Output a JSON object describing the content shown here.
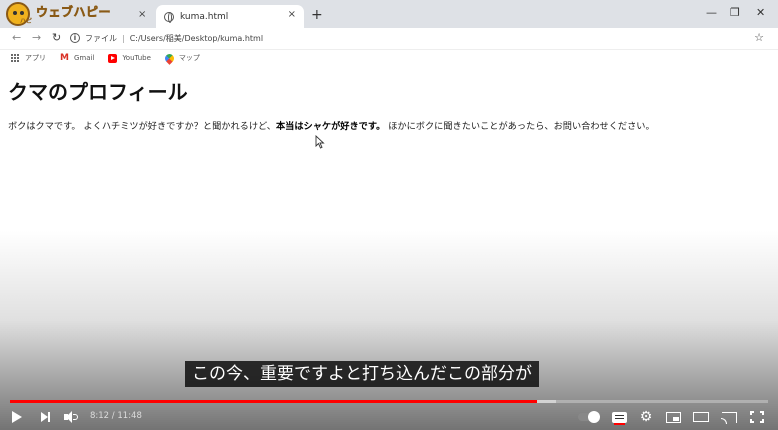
{
  "browser": {
    "tabs": [
      {
        "label": "",
        "active": false
      },
      {
        "label": "kuma.html",
        "active": true
      }
    ],
    "tab_close_glyph": "×",
    "new_tab_glyph": "+",
    "window_controls": [
      "—",
      "❐",
      "✕"
    ],
    "address": {
      "scheme_label": "ファイル",
      "path": "C:/Users/稲美/Desktop/kuma.html"
    },
    "bookmarks": [
      {
        "label": "アプリ",
        "icon": "apps-icon"
      },
      {
        "label": "Gmail",
        "icon": "gmail-icon"
      },
      {
        "label": "YouTube",
        "icon": "youtube-icon"
      },
      {
        "label": "マップ",
        "icon": "maps-icon"
      }
    ]
  },
  "logo": {
    "text": "ウェブハピー",
    "sub": "ハピ"
  },
  "page": {
    "title": "クマのプロフィール",
    "para_before": "ボクはクマです。 よくハチミツが好きですか？と聞かれるけど、",
    "para_strong": "本当はシャケが好きです。",
    "para_after": " ほかにボクに聞きたいことがあったら、お問い合わせください。"
  },
  "video": {
    "caption": "この今、重要ですよと打ち込んだこの部分が",
    "time_current": "8:12",
    "time_total": "11:48",
    "time_separator": " / ",
    "progress_fraction": 0.695,
    "buffer_fraction": 0.72,
    "progress_color": "#ff0000"
  }
}
